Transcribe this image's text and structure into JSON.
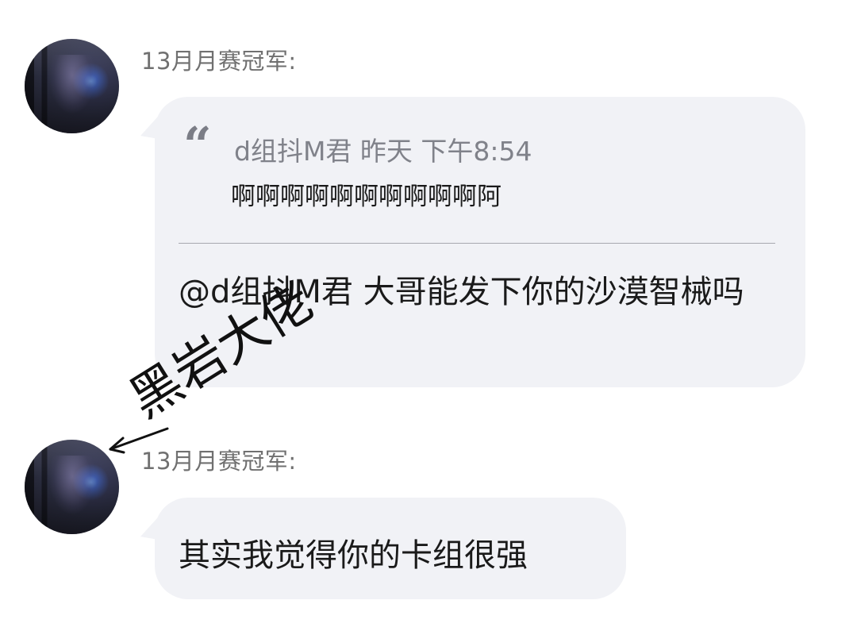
{
  "messages": [
    {
      "sender": "13月月赛冠军:",
      "quote": {
        "meta": "d组抖M君 昨天 下午8:54",
        "body": "啊啊啊啊啊啊啊啊啊啊阿"
      },
      "text": "@d组抖M君 大哥能发下你的沙漠智械吗"
    },
    {
      "sender": "13月月赛冠军:",
      "text": "其实我觉得你的卡组很强"
    }
  ],
  "annotation": {
    "text": "黑岩大佬"
  },
  "icons": {
    "quote": "quote-icon",
    "arrow": "arrow-left-icon"
  },
  "colors": {
    "bubble": "#f1f2f6",
    "name": "#707070",
    "quote_meta": "#80828a"
  }
}
